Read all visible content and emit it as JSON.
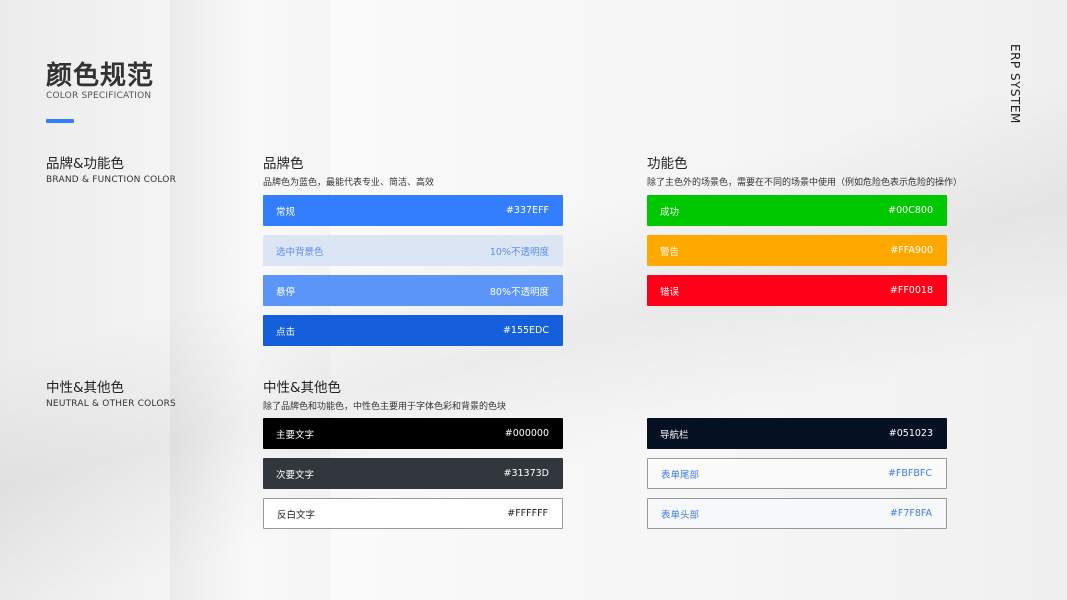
{
  "header": {
    "title": "颜色规范",
    "subtitle": "COLOR SPECIFICATION",
    "accent_color": "#337EFF"
  },
  "side_label": "ERP SYSTEM",
  "sections": {
    "brand_function": {
      "name": "品牌&功能色",
      "en": "BRAND & FUNCTION COLOR"
    },
    "neutral_other": {
      "name": "中性&其他色",
      "en": "NEUTRAL & OTHER COLORS"
    }
  },
  "brand": {
    "title": "品牌色",
    "desc": "品牌色为蓝色，最能代表专业、简洁、高效",
    "swatches": [
      {
        "label": "常规",
        "value": "#337EFF",
        "bg": "#337EFF",
        "fg": "#FFFFFF"
      },
      {
        "label": "选中背景色",
        "value": "10%不透明度",
        "bg": "#DCE5F4",
        "fg": "#5B8DEF"
      },
      {
        "label": "悬停",
        "value": "80%不透明度",
        "bg": "#5B95FA",
        "fg": "#FFFFFF"
      },
      {
        "label": "点击",
        "value": "#155EDC",
        "bg": "#155EDC",
        "fg": "#FFFFFF"
      }
    ]
  },
  "function": {
    "title": "功能色",
    "desc": "除了主色外的场景色，需要在不同的场景中使用（例如危险色表示危险的操作）",
    "swatches": [
      {
        "label": "成功",
        "value": "#00C800",
        "bg": "#00C800",
        "fg": "#FFFFFF"
      },
      {
        "label": "警告",
        "value": "#FFA900",
        "bg": "#FFA900",
        "fg": "#FFFFFF"
      },
      {
        "label": "错误",
        "value": "#FF0018",
        "bg": "#FF0018",
        "fg": "#FFFFFF"
      }
    ]
  },
  "neutral": {
    "title": "中性&其他色",
    "desc": "除了品牌色和功能色，中性色主要用于字体色彩和背景的色块",
    "swatches": [
      {
        "label": "主要文字",
        "value": "#000000",
        "bg": "#000000",
        "fg": "#FFFFFF"
      },
      {
        "label": "次要文字",
        "value": "#31373D",
        "bg": "#31373D",
        "fg": "#FFFFFF"
      },
      {
        "label": "反白文字",
        "value": "#FFFFFF",
        "bg": "#FFFFFF",
        "fg": "#222222",
        "border": "#999999"
      }
    ]
  },
  "other": {
    "swatches": [
      {
        "label": "导航栏",
        "value": "#051023",
        "bg": "#051023",
        "fg": "#FFFFFF"
      },
      {
        "label": "表单尾部",
        "value": "#FBFBFC",
        "bg": "#FBFBFC",
        "fg": "#3F7DE8",
        "border": "#999999"
      },
      {
        "label": "表单头部",
        "value": "#F7F8FA",
        "bg": "#F7F8FA",
        "fg": "#3F7DE8",
        "border": "#999999"
      }
    ]
  }
}
